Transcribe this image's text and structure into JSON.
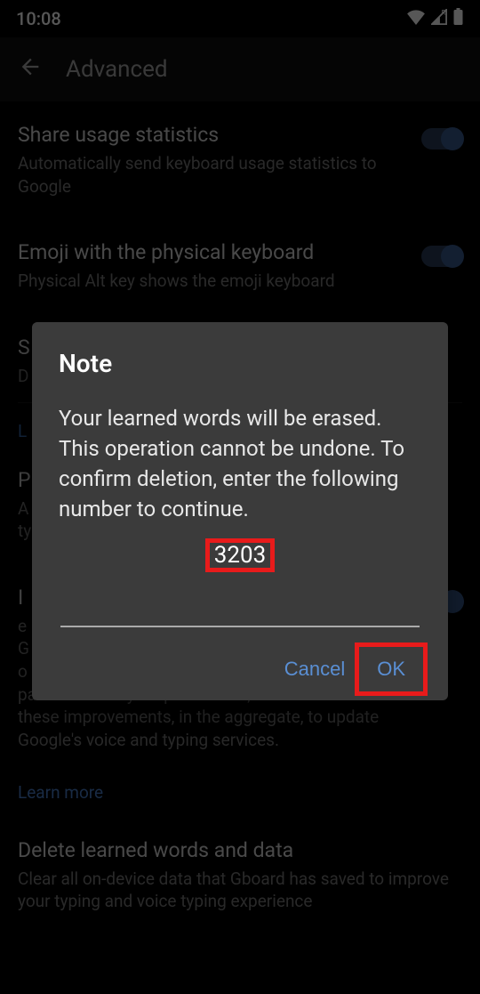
{
  "status": {
    "time": "10:08"
  },
  "header": {
    "title": "Advanced"
  },
  "settings": [
    {
      "title": "Share usage statistics",
      "sub": "Automatically send keyboard usage statistics to Google",
      "toggle": true
    },
    {
      "title": "Emoji with the physical keyboard",
      "sub": "Physical Alt key shows the emoji keyboard",
      "toggle": true
    },
    {
      "title": "S",
      "sub": "D",
      "toggle": false
    },
    {
      "title": "P",
      "sub": "A\nty",
      "toggle": false
    },
    {
      "title": "I",
      "sub": "e\nG\no\npatterns. With your permission, Gboard will use these improvements, in the aggregate, to update Google's voice and typing services.",
      "toggle": true
    },
    {
      "title": "Delete learned words and data",
      "sub": "Clear all on-device data that Gboard has saved to improve your typing and voice typing experience",
      "toggle": false
    }
  ],
  "section_label": "L",
  "learn_more": "Learn more",
  "dialog": {
    "title": "Note",
    "message": "Your learned words will be erased. This operation cannot be undone. To confirm deletion, enter the following number to continue.",
    "number": "3203",
    "cancel": "Cancel",
    "ok": "OK"
  }
}
